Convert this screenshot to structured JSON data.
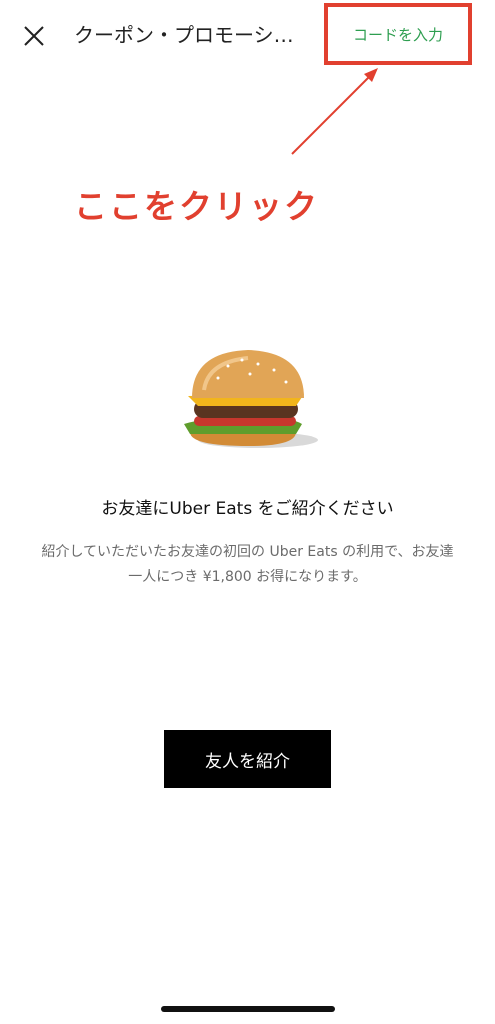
{
  "header": {
    "close_icon": "close-icon",
    "title": "クーポン・プロモーシ…",
    "enter_code_label": "コードを入力"
  },
  "annotation": {
    "text": "ここをクリック",
    "color": "#e1402f"
  },
  "main": {
    "image_icon": "burger-illustration",
    "headline": "お友達にUber Eats をご紹介ください",
    "description": "紹介していただいたお友達の初回の Uber Eats の利用で、お友達一人につき ¥1,800 お得になります。",
    "refer_button_label": "友人を紹介"
  },
  "colors": {
    "accent_green": "#2e9e50",
    "highlight_red": "#e1402f",
    "button_bg": "#000000"
  }
}
